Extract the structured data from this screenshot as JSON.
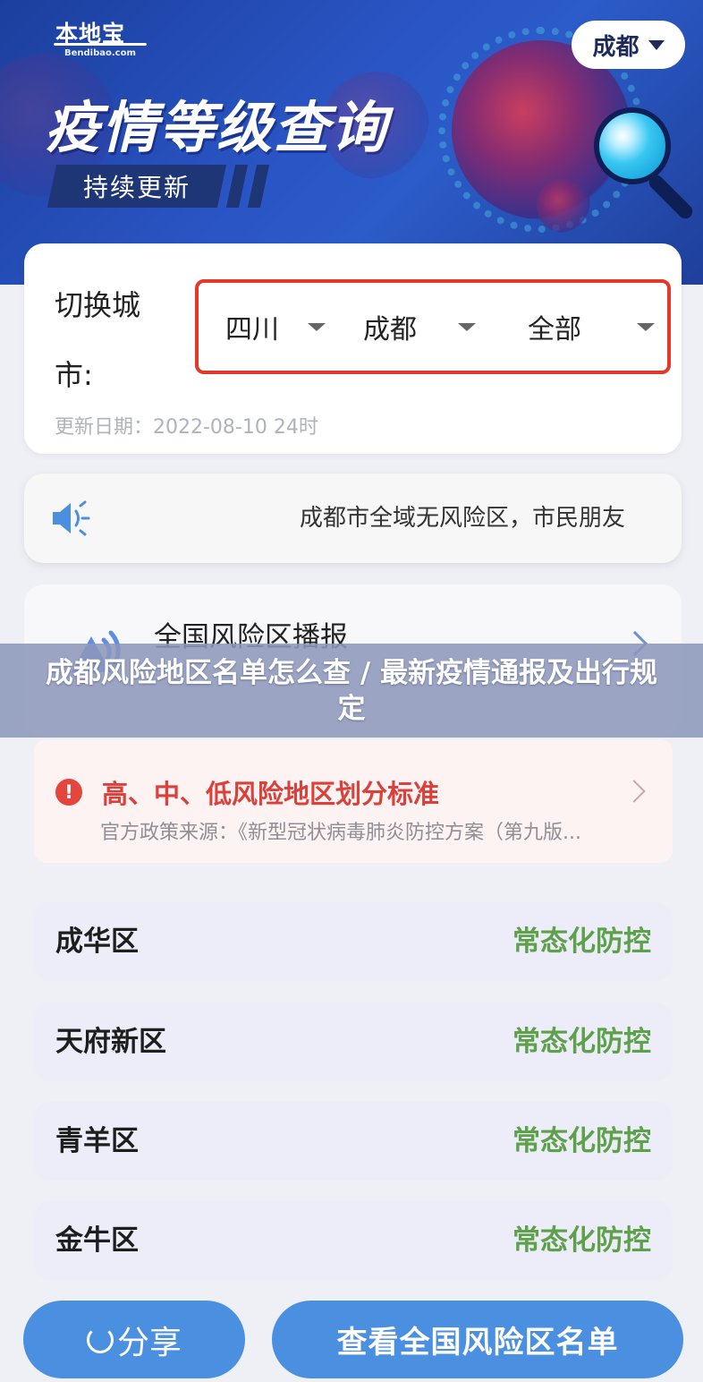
{
  "header": {
    "logo_text": "本地宝",
    "logo_sub": "Bendibao.com",
    "title": "疫情等级查询",
    "subtitle": "持续更新",
    "city_pill": "成都"
  },
  "city_selector": {
    "label": "切换城市:",
    "province": "四川",
    "city": "成都",
    "district": "全部",
    "update_date": "更新日期：2022-08-10 24时"
  },
  "notice": {
    "text": "成都市全域无风险区，市民朋友"
  },
  "national": {
    "title": "全国风险区播报"
  },
  "overlay": {
    "title": "成都风险地区名单怎么查 / 最新疫情通报及出行规定"
  },
  "standard": {
    "title": "高、中、低风险地区划分标准",
    "source": "官方政策来源：《新型冠状病毒肺炎防控方案（第九版..."
  },
  "districts": [
    {
      "name": "成华区",
      "status": "常态化防控"
    },
    {
      "name": "天府新区",
      "status": "常态化防控"
    },
    {
      "name": "青羊区",
      "status": "常态化防控"
    },
    {
      "name": "金牛区",
      "status": "常态化防控"
    }
  ],
  "buttons": {
    "share": "分享",
    "national_list": "查看全国风险区名单"
  },
  "colors": {
    "banner_blue": "#2a55c4",
    "alert_red": "#d9413a",
    "status_green": "#5ea14b",
    "button_blue": "#4a8fe0"
  }
}
